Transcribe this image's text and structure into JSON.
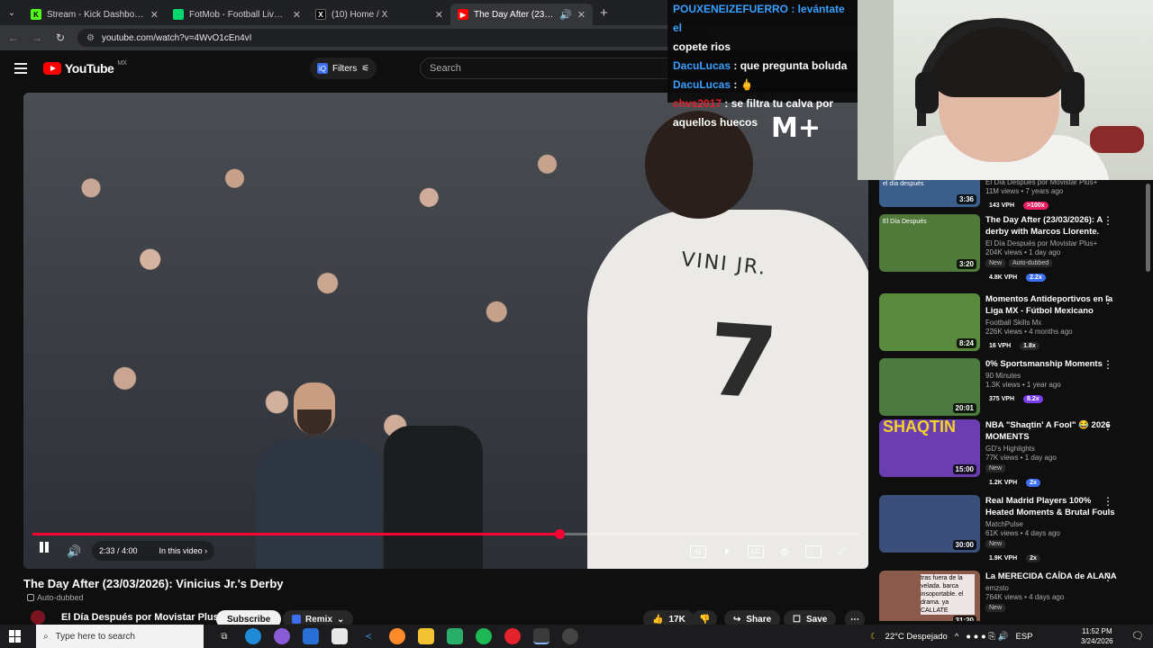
{
  "browser": {
    "tabs": [
      {
        "title": "Stream - Kick Dashboard",
        "favicon_color": "#53fc18",
        "active": false
      },
      {
        "title": "FotMob - Football Live Scores",
        "favicon_color": "#06d66e",
        "active": false
      },
      {
        "title": "(10) Home / X",
        "favicon_color": "#ffffff",
        "active": false
      },
      {
        "title": "The Day After (23/03/2026",
        "favicon_color": "#ff0000",
        "active": true
      }
    ],
    "url": "youtube.com/watch?v=4WvO1cEn4vI"
  },
  "youtube": {
    "logo_text": "YouTube",
    "country": "MX",
    "filters_label": "Filters",
    "search_placeholder": "Search"
  },
  "chat": [
    {
      "user": "FOUXENEIZEFUERRO",
      "text": "levántate el copete rios",
      "user_color": "#3aa0ff",
      "display": "POUXENEIZEFUERRO : levántate el"
    },
    {
      "user": "",
      "text": "copete rios"
    },
    {
      "user": "DacuLucas",
      "text": "que pregunta boluda",
      "user_color": "#3aa0ff"
    },
    {
      "user": "DacuLucas",
      "text": "",
      "user_color": "#3aa0ff"
    },
    {
      "user": "chvs2017",
      "text": "se filtra tu calva por",
      "user_color": "#e3222b"
    },
    {
      "user": "",
      "text": "aquellos huecos"
    }
  ],
  "player": {
    "current_time": "2:33",
    "duration": "4:00",
    "time_display": "2:33 / 4:00",
    "progress_fraction": 0.6375,
    "chapters_label": "In this video",
    "jersey_name": "VINI JR.",
    "jersey_number": "7",
    "broadcaster_logo": "M+"
  },
  "video": {
    "title": "The Day After (23/03/2026): Vinicius Jr.'s Derby",
    "auto_dubbed": "Auto-dubbed",
    "channel": "El Día Después por Movistar Plus+",
    "subscribe": "Subscribe",
    "remix": "Remix",
    "likes": "17K",
    "share": "Share",
    "save": "Save"
  },
  "recommendations": [
    {
      "title": "",
      "channel": "El Día Después por Movistar Plus+",
      "views": "11M views • 7 years ago",
      "duration": "3:36",
      "vph": "143 VPH",
      "ratio": ">100x",
      "ratio_color": "#e91e63",
      "thumb_color": "#3b5f8a",
      "thumb_label": "el día después",
      "new": "",
      "dubbed": ""
    },
    {
      "title": "The Day After (23/03/2026): A derby with Marcos Llorente.",
      "channel": "El Día Después por Movistar Plus+",
      "views": "204K views • 1 day ago",
      "duration": "3:20",
      "vph": "4.8K VPH",
      "ratio": "2.2x",
      "ratio_color": "#3b6ef0",
      "thumb_color": "#4f7a3a",
      "thumb_label": "El Día Después",
      "new": "New",
      "dubbed": "Auto-dubbed"
    },
    {
      "title": "Momentos Antideportivos en la Liga MX - Fútbol Mexicano",
      "channel": "Football Skills Mx",
      "views": "226K views • 4 months ago",
      "duration": "8:24",
      "vph": "16 VPH",
      "ratio": "1.8x",
      "ratio_color": "#272727",
      "thumb_color": "#5a8a3d",
      "thumb_label": "",
      "new": "",
      "dubbed": ""
    },
    {
      "title": "0% Sportsmanship Moments",
      "channel": "90 Minutes",
      "views": "1.3K views • 1 year ago",
      "duration": "20:01",
      "vph": "375 VPH",
      "ratio": "8.2x",
      "ratio_color": "#7a3cf0",
      "thumb_color": "#4d7a3e",
      "thumb_label": "",
      "new": "",
      "dubbed": ""
    },
    {
      "title": "NBA \"Shaqtin' A Fool\" 😂 2026 MOMENTS",
      "channel": "GD's Highlights",
      "views": "77K views • 1 day ago",
      "duration": "15:00",
      "vph": "1.2K VPH",
      "ratio": "2x",
      "ratio_color": "#3b6ef0",
      "thumb_color": "#6a3db0",
      "thumb_label": "SHAQTIN",
      "new": "New",
      "dubbed": ""
    },
    {
      "title": "Real Madrid Players 100% Heated Moments & Brutal Fouls",
      "channel": "MatchPulse",
      "views": "61K views • 4 days ago",
      "duration": "30:00",
      "vph": "1.9K VPH",
      "ratio": "2x",
      "ratio_color": "#272727",
      "thumb_color": "#3a4f7a",
      "thumb_label": "",
      "new": "New",
      "dubbed": ""
    },
    {
      "title": "La MERECIDA CAÍDA de ALANA",
      "channel": "emzsto",
      "views": "764K views • 4 days ago",
      "duration": "31:20",
      "vph": "",
      "ratio": "",
      "ratio_color": "#3b6ef0",
      "thumb_color": "#8a5a4a",
      "thumb_label": "tras fuera de la velada. barca insoportable. el drama. ya CALLATE",
      "new": "New",
      "dubbed": ""
    }
  ],
  "taskbar": {
    "search_placeholder": "Type here to search",
    "weather": "22°C  Despejado",
    "language": "ESP",
    "time": "11:52 PM",
    "date": "3/24/2026"
  }
}
